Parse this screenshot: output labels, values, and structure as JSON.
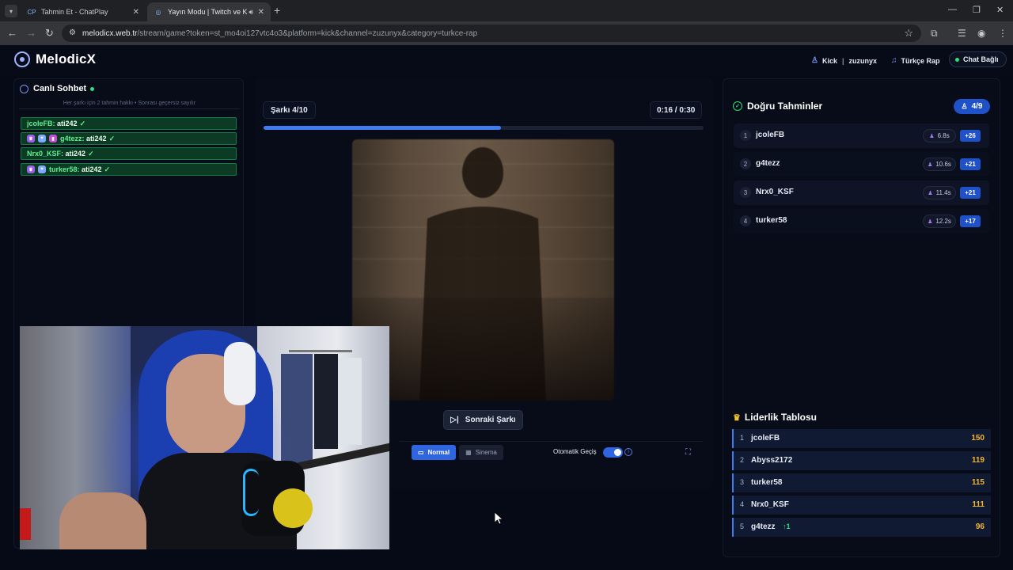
{
  "browser": {
    "tabs": [
      {
        "title": "Tahmin Et - ChatPlay",
        "favicon": "CP"
      },
      {
        "title": "Yayın Modu | Twitch ve Kick"
      }
    ],
    "url_host": "melodicx.web.tr",
    "url_path": "/stream/game?token=st_mo4oi127vtc4o3&platform=kick&channel=zuzunyx&category=turkce-rap"
  },
  "header": {
    "brand": "MelodicX",
    "platform": "Kick",
    "separator": "|",
    "channel": "zuzunyx",
    "category": "Türkçe Rap",
    "chat_status": "Chat Bağlı"
  },
  "chat": {
    "title": "Canlı Sohbet",
    "hint": "Her şarkı için 2 tahmin hakkı • Sonrası geçersiz sayılır",
    "messages": [
      {
        "user": "jcoleFB:",
        "text": "ati242",
        "check": "✓"
      },
      {
        "user": "g4tezz:",
        "text": "ati242",
        "check": "✓"
      },
      {
        "user": "Nrx0_KSF:",
        "text": "ati242",
        "check": "✓"
      },
      {
        "user": "turker58:",
        "text": "ati242",
        "check": "✓"
      }
    ]
  },
  "game": {
    "song_counter": "Şarkı 4/10",
    "timer": "0:16 / 0:30",
    "progress": 0.54,
    "next_label": "Sonraki Şarkı",
    "mode_normal": "Normal",
    "mode_cinema": "Sinema",
    "auto_label": "Otomatik Geçiş"
  },
  "guesses": {
    "title": "Doğru Tahminler",
    "count": "4/9",
    "rows": [
      {
        "rank": "1",
        "name": "jcoleFB",
        "time": "6.8s",
        "points": "+26"
      },
      {
        "rank": "2",
        "name": "g4tezz",
        "time": "10.6s",
        "points": "+21"
      },
      {
        "rank": "3",
        "name": "Nrx0_KSF",
        "time": "11.4s",
        "points": "+21"
      },
      {
        "rank": "4",
        "name": "turker58",
        "time": "12.2s",
        "points": "+17"
      }
    ]
  },
  "leaderboard": {
    "title": "Liderlik Tablosu",
    "rows": [
      {
        "rank": "1",
        "name": "jcoleFB",
        "delta": "",
        "score": "150"
      },
      {
        "rank": "2",
        "name": "Abyss2172",
        "delta": "",
        "score": "119"
      },
      {
        "rank": "3",
        "name": "turker58",
        "delta": "",
        "score": "115"
      },
      {
        "rank": "4",
        "name": "Nrx0_KSF",
        "delta": "",
        "score": "111"
      },
      {
        "rank": "5",
        "name": "g4tezz",
        "delta": "↑1",
        "score": "96"
      }
    ]
  },
  "colors": {
    "accent": "#3e7cf2",
    "success": "#2ee07a",
    "gold": "#f2b530"
  }
}
